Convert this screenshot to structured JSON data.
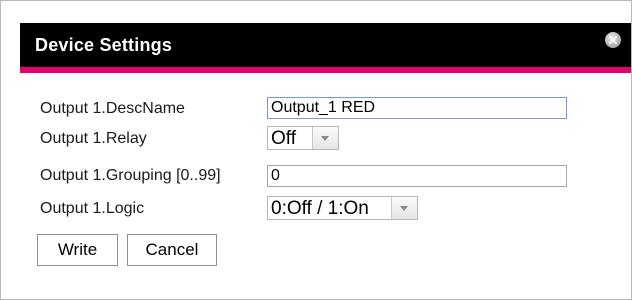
{
  "dialog": {
    "title": "Device Settings",
    "close_icon": "close-icon"
  },
  "colors": {
    "titlebar": "#000000",
    "accent": "#e6006f"
  },
  "fields": {
    "descname": {
      "label": "Output 1.DescName",
      "value": "Output_1 RED"
    },
    "relay": {
      "label": "Output 1.Relay",
      "value": "Off"
    },
    "grouping": {
      "label": "Output 1.Grouping [0..99]",
      "value": "0"
    },
    "logic": {
      "label": "Output 1.Logic",
      "value": "0:Off / 1:On"
    }
  },
  "buttons": {
    "write": "Write",
    "cancel": "Cancel"
  }
}
